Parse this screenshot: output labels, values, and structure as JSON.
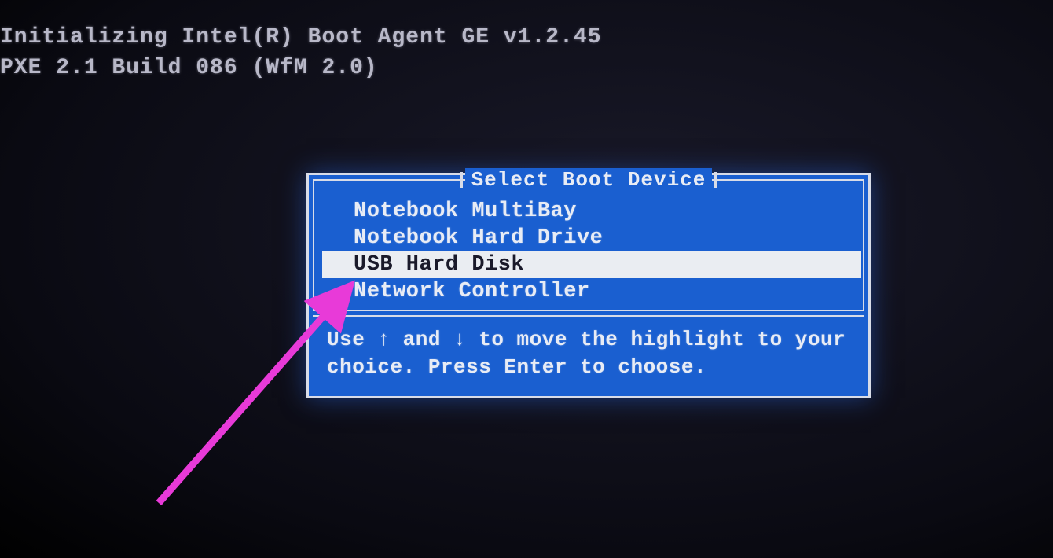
{
  "boot": {
    "line1": "Initializing Intel(R) Boot Agent GE v1.2.45",
    "line2": "PXE 2.1 Build 086 (WfM 2.0)"
  },
  "menu": {
    "title": "Select Boot Device",
    "items": [
      {
        "label": "Notebook MultiBay",
        "selected": false
      },
      {
        "label": "Notebook Hard Drive",
        "selected": false
      },
      {
        "label": "USB Hard Disk",
        "selected": true
      },
      {
        "label": "Network Controller",
        "selected": false
      }
    ],
    "help": "Use ↑ and ↓ to move the highlight to your choice.  Press Enter to choose."
  },
  "annotation": {
    "arrow_color": "#e83ad8"
  }
}
